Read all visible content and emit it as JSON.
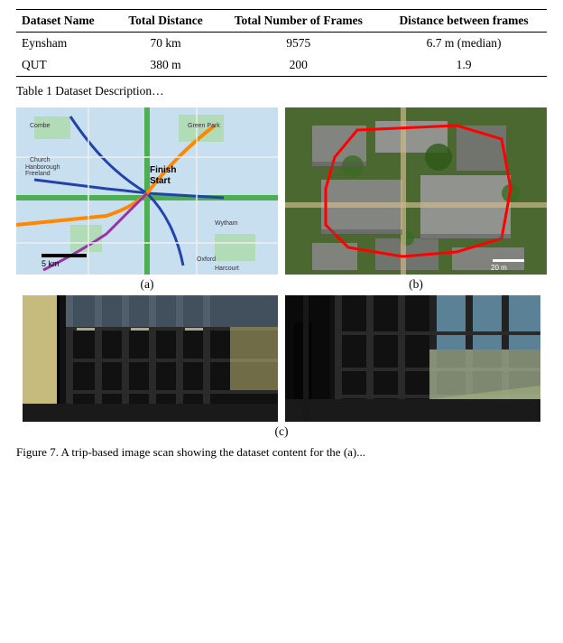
{
  "table": {
    "headers": [
      "Dataset Name",
      "Total Distance",
      "Total Number of Frames",
      "Distance between frames"
    ],
    "rows": [
      [
        "Eynsham",
        "70 km",
        "9575",
        "6.7 m (median)"
      ],
      [
        "QUT",
        "380 m",
        "200",
        "1.9"
      ]
    ]
  },
  "caption": "Table 1 Dataset Description…",
  "labels": {
    "a": "(a)",
    "b": "(b)",
    "c": "(c)"
  },
  "figure_caption": "Figure 7. A trip-based image scan showing the dataset content for the (a)..."
}
